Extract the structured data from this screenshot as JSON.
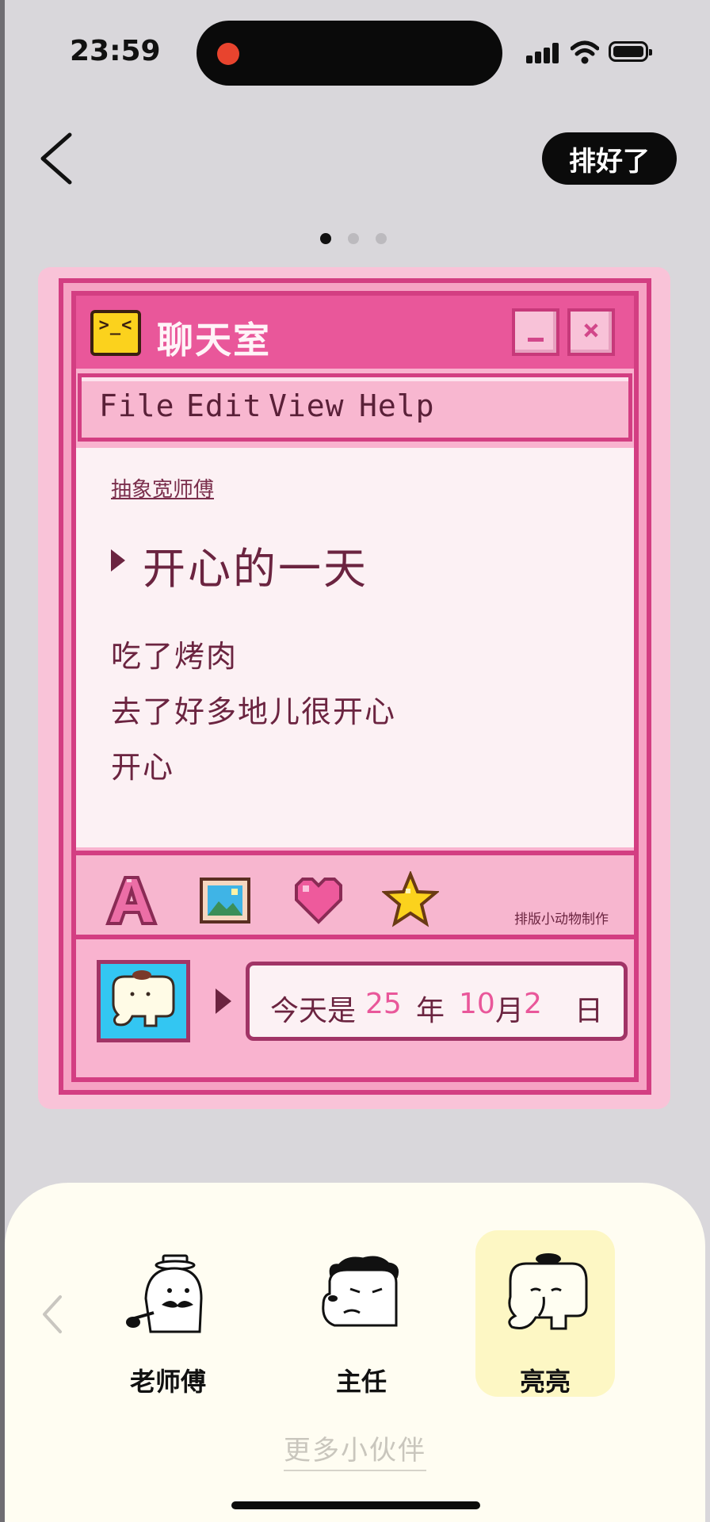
{
  "status_bar": {
    "time": "23:59"
  },
  "nav": {
    "done_label": "排好了"
  },
  "pager": {
    "pages": 3,
    "active": 0
  },
  "window": {
    "title": "聊天室",
    "title_icon_face": ">_<",
    "menu": [
      "File",
      "Edit",
      "View",
      "Help"
    ],
    "author": "抽象宽师傅",
    "entry_title": "开心的一天",
    "entry_lines": [
      "吃了烤肉",
      "去了好多地儿很开心",
      "开心"
    ],
    "toolbar_icons": [
      "letter-a-icon",
      "picture-icon",
      "heart-icon",
      "star-icon"
    ],
    "credit": "排版小动物制作",
    "date": {
      "prefix": "今天是",
      "year": "25",
      "year_unit": "年",
      "month": "10",
      "month_unit": "月",
      "day": "2",
      "day_unit": "日"
    }
  },
  "characters": {
    "items": [
      {
        "name": "老师傅",
        "selected": false
      },
      {
        "name": "主任",
        "selected": false
      },
      {
        "name": "亮亮",
        "selected": true
      }
    ],
    "more_label": "更多小伙伴"
  },
  "colors": {
    "accent_pink": "#e9579a",
    "window_border": "#d33e82",
    "text_dark_rose": "#6b2440",
    "selected_bg": "#fdf7c4"
  }
}
